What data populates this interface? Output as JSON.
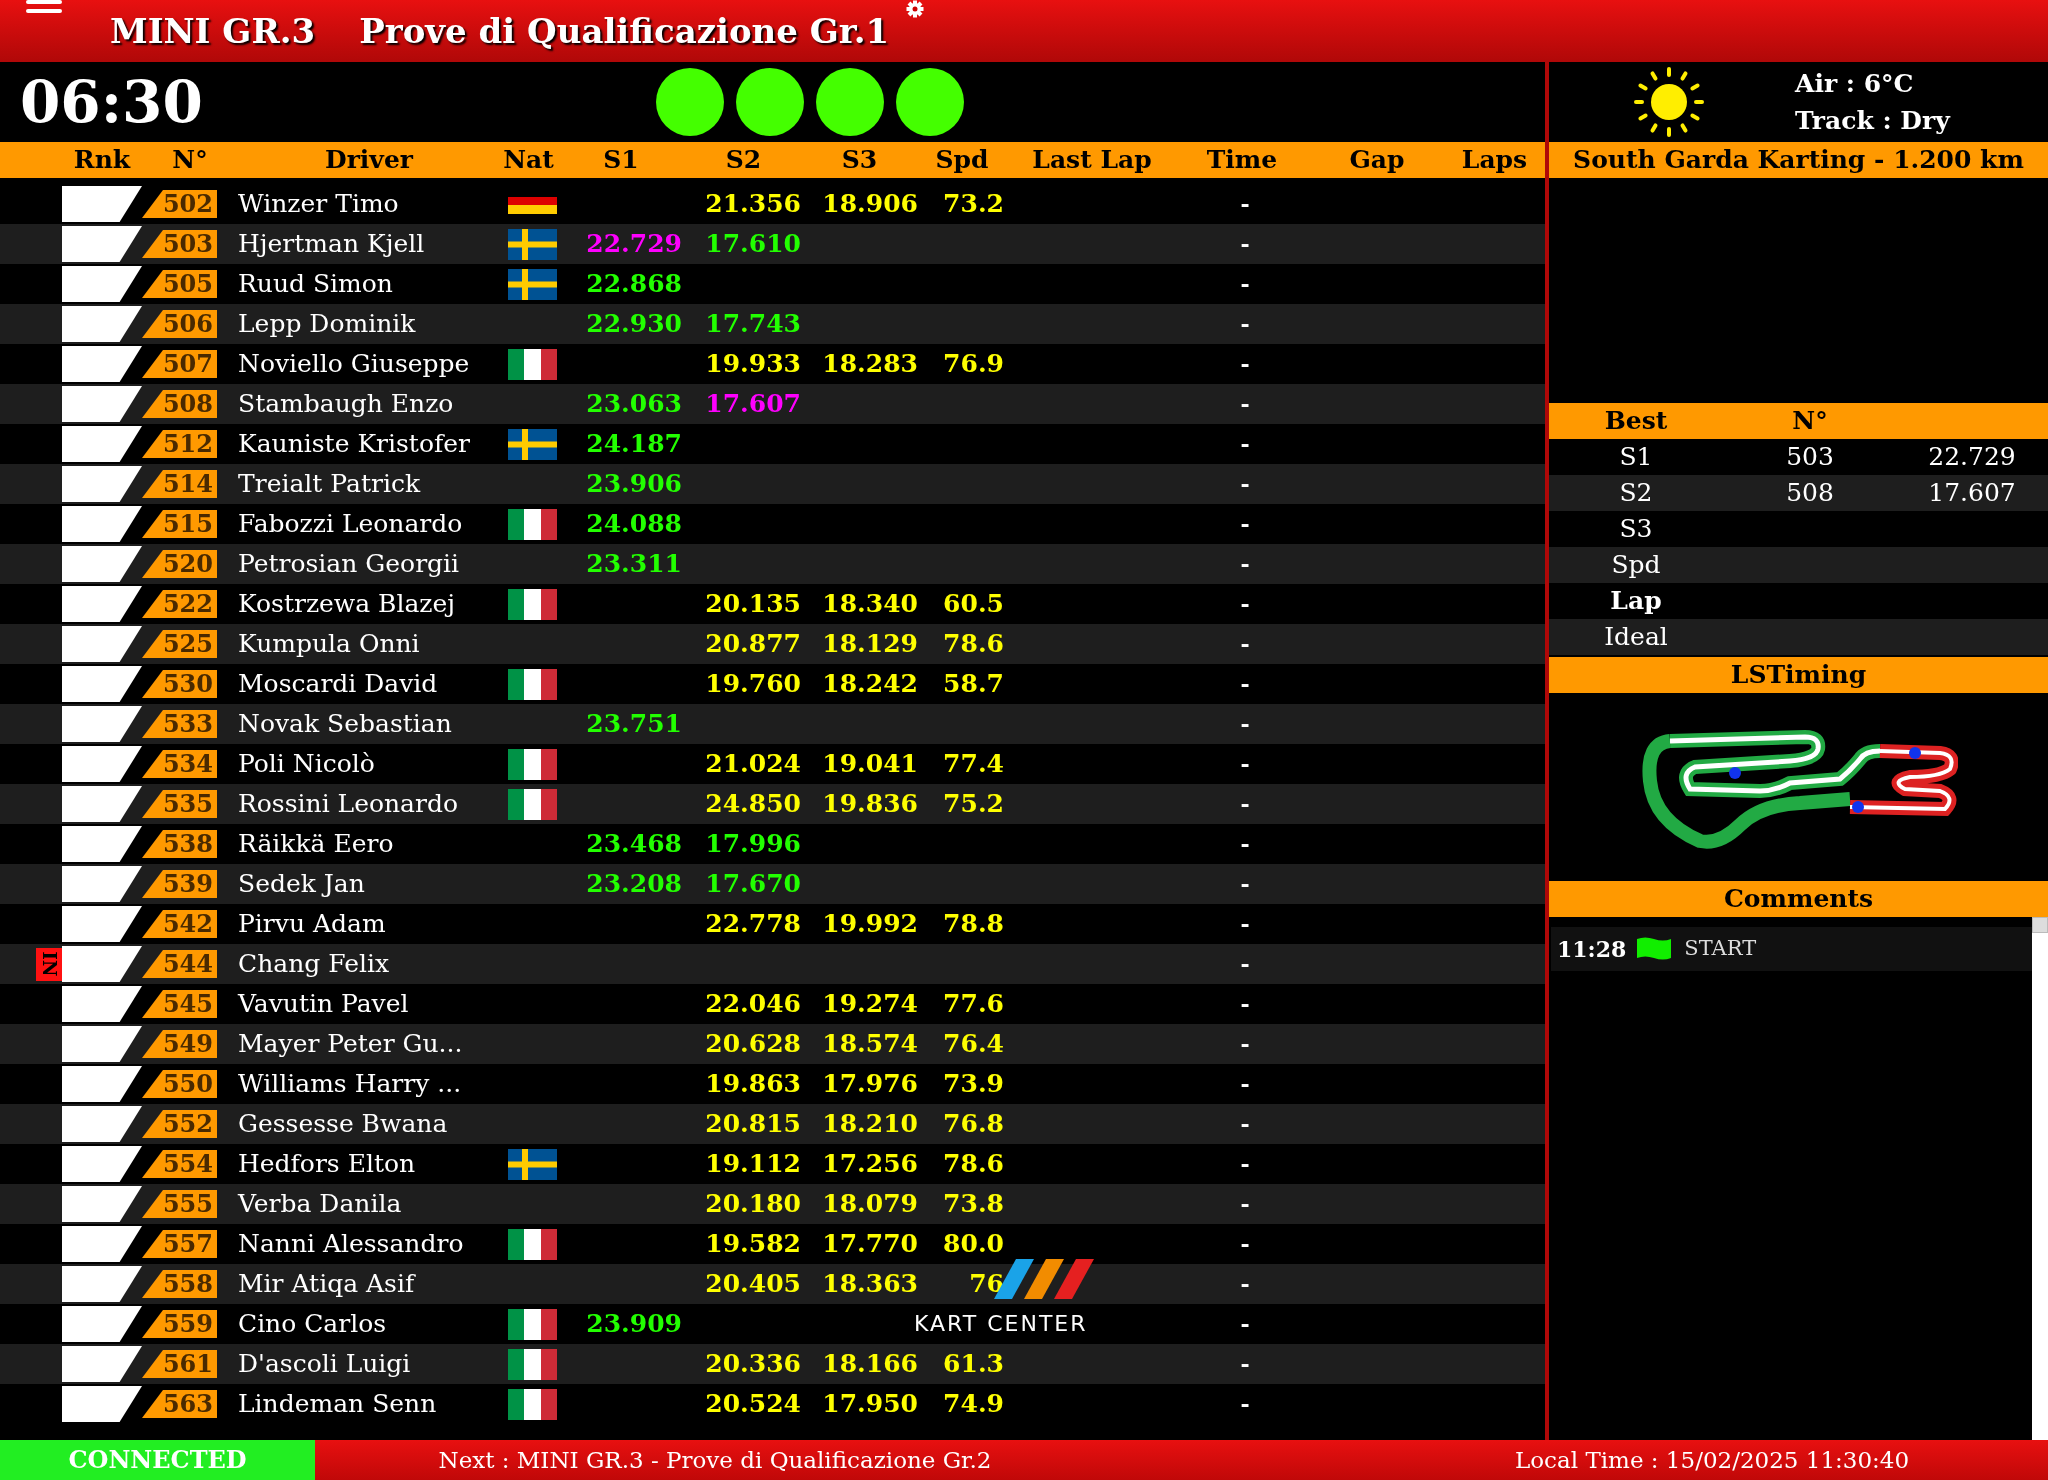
{
  "header": {
    "category": "MINI GR.3",
    "session": "Prove di Qualificazione Gr.1"
  },
  "timer": "06:30",
  "lights": [
    {
      "on": true
    },
    {
      "on": true
    },
    {
      "on": true
    },
    {
      "on": true
    }
  ],
  "columns": [
    "Rnk",
    "N°",
    "Driver",
    "Nat",
    "S1",
    "S2",
    "S3",
    "Spd",
    "Last Lap",
    "Time",
    "Gap",
    "Laps"
  ],
  "rows": [
    {
      "number": "502",
      "driver": "Winzer Timo",
      "nat": {
        "kind": "de"
      },
      "s2": {
        "text": "21.356",
        "kind": "normal"
      },
      "s3": {
        "text": "18.906",
        "kind": "normal"
      },
      "spd": "73.2",
      "time": "-"
    },
    {
      "number": "503",
      "driver": "Hjertman Kjell",
      "nat": {
        "kind": "se"
      },
      "s1": {
        "text": "22.729",
        "kind": "overall"
      },
      "s2": {
        "text": "17.610",
        "kind": "personal"
      },
      "time": "-"
    },
    {
      "number": "505",
      "driver": "Ruud Simon",
      "nat": {
        "kind": "se"
      },
      "s1": {
        "text": "22.868",
        "kind": "personal"
      },
      "time": "-"
    },
    {
      "number": "506",
      "driver": "Lepp Dominik",
      "s1": {
        "text": "22.930",
        "kind": "personal"
      },
      "s2": {
        "text": "17.743",
        "kind": "personal"
      },
      "time": "-"
    },
    {
      "number": "507",
      "driver": "Noviello Giuseppe",
      "nat": {
        "kind": "it"
      },
      "s2": {
        "text": "19.933",
        "kind": "normal"
      },
      "s3": {
        "text": "18.283",
        "kind": "normal"
      },
      "spd": "76.9",
      "time": "-"
    },
    {
      "number": "508",
      "driver": "Stambaugh Enzo",
      "s1": {
        "text": "23.063",
        "kind": "personal"
      },
      "s2": {
        "text": "17.607",
        "kind": "overall"
      },
      "time": "-"
    },
    {
      "number": "512",
      "driver": "Kauniste Kristofer",
      "nat": {
        "kind": "se"
      },
      "s1": {
        "text": "24.187",
        "kind": "personal"
      },
      "time": "-"
    },
    {
      "number": "514",
      "driver": "Treialt Patrick",
      "s1": {
        "text": "23.906",
        "kind": "personal"
      },
      "time": "-"
    },
    {
      "number": "515",
      "driver": "Fabozzi Leonardo",
      "nat": {
        "kind": "it"
      },
      "s1": {
        "text": "24.088",
        "kind": "personal"
      },
      "time": "-"
    },
    {
      "number": "520",
      "driver": "Petrosian Georgii",
      "s1": {
        "text": "23.311",
        "kind": "personal"
      },
      "time": "-"
    },
    {
      "number": "522",
      "driver": "Kostrzewa Blazej",
      "nat": {
        "kind": "it"
      },
      "s2": {
        "text": "20.135",
        "kind": "normal"
      },
      "s3": {
        "text": "18.340",
        "kind": "normal"
      },
      "spd": "60.5",
      "time": "-"
    },
    {
      "number": "525",
      "driver": "Kumpula Onni",
      "s2": {
        "text": "20.877",
        "kind": "normal"
      },
      "s3": {
        "text": "18.129",
        "kind": "normal"
      },
      "spd": "78.6",
      "time": "-"
    },
    {
      "number": "530",
      "driver": "Moscardi David",
      "nat": {
        "kind": "it"
      },
      "s2": {
        "text": "19.760",
        "kind": "normal"
      },
      "s3": {
        "text": "18.242",
        "kind": "normal"
      },
      "spd": "58.7",
      "time": "-"
    },
    {
      "number": "533",
      "driver": "Novak Sebastian",
      "s1": {
        "text": "23.751",
        "kind": "personal"
      },
      "time": "-"
    },
    {
      "number": "534",
      "driver": "Poli Nicolò",
      "nat": {
        "kind": "it"
      },
      "s2": {
        "text": "21.024",
        "kind": "normal"
      },
      "s3": {
        "text": "19.041",
        "kind": "normal"
      },
      "spd": "77.4",
      "time": "-"
    },
    {
      "number": "535",
      "driver": "Rossini Leonardo",
      "nat": {
        "kind": "it"
      },
      "s2": {
        "text": "24.850",
        "kind": "normal"
      },
      "s3": {
        "text": "19.836",
        "kind": "normal"
      },
      "spd": "75.2",
      "time": "-"
    },
    {
      "number": "538",
      "driver": "Räikkä Eero",
      "s1": {
        "text": "23.468",
        "kind": "personal"
      },
      "s2": {
        "text": "17.996",
        "kind": "personal"
      },
      "time": "-"
    },
    {
      "number": "539",
      "driver": "Sedek Jan",
      "s1": {
        "text": "23.208",
        "kind": "personal"
      },
      "s2": {
        "text": "17.670",
        "kind": "personal"
      },
      "time": "-"
    },
    {
      "number": "542",
      "driver": "Pirvu Adam",
      "s2": {
        "text": "22.778",
        "kind": "normal"
      },
      "s3": {
        "text": "19.992",
        "kind": "normal"
      },
      "spd": "78.8",
      "time": "-"
    },
    {
      "number": "544",
      "driver": "Chang Felix",
      "status": "IN",
      "time": "-"
    },
    {
      "number": "545",
      "driver": "Vavutin Pavel",
      "s2": {
        "text": "22.046",
        "kind": "normal"
      },
      "s3": {
        "text": "19.274",
        "kind": "normal"
      },
      "spd": "77.6",
      "time": "-"
    },
    {
      "number": "549",
      "driver": "Mayer Peter Gu...",
      "s2": {
        "text": "20.628",
        "kind": "normal"
      },
      "s3": {
        "text": "18.574",
        "kind": "normal"
      },
      "spd": "76.4",
      "time": "-"
    },
    {
      "number": "550",
      "driver": "Williams Harry ...",
      "s2": {
        "text": "19.863",
        "kind": "normal"
      },
      "s3": {
        "text": "17.976",
        "kind": "normal"
      },
      "spd": "73.9",
      "time": "-"
    },
    {
      "number": "552",
      "driver": "Gessesse Bwana",
      "s2": {
        "text": "20.815",
        "kind": "normal"
      },
      "s3": {
        "text": "18.210",
        "kind": "normal"
      },
      "spd": "76.8",
      "time": "-"
    },
    {
      "number": "554",
      "driver": "Hedfors Elton",
      "nat": {
        "kind": "se"
      },
      "s2": {
        "text": "19.112",
        "kind": "normal"
      },
      "s3": {
        "text": "17.256",
        "kind": "normal"
      },
      "spd": "78.6",
      "time": "-"
    },
    {
      "number": "555",
      "driver": "Verba Danila",
      "s2": {
        "text": "20.180",
        "kind": "normal"
      },
      "s3": {
        "text": "18.079",
        "kind": "normal"
      },
      "spd": "73.8",
      "time": "-"
    },
    {
      "number": "557",
      "driver": "Nanni Alessandro",
      "nat": {
        "kind": "it"
      },
      "s2": {
        "text": "19.582",
        "kind": "normal"
      },
      "s3": {
        "text": "17.770",
        "kind": "normal"
      },
      "spd": "80.0",
      "time": "-"
    },
    {
      "number": "558",
      "driver": "Mir Atiqa Asif",
      "s2": {
        "text": "20.405",
        "kind": "normal"
      },
      "s3": {
        "text": "18.363",
        "kind": "normal"
      },
      "spd": "76",
      "time": "-"
    },
    {
      "number": "559",
      "driver": "Cino Carlos",
      "nat": {
        "kind": "it"
      },
      "s1": {
        "text": "23.909",
        "kind": "personal"
      },
      "time": "-"
    },
    {
      "number": "561",
      "driver": "D'ascoli Luigi",
      "nat": {
        "kind": "it"
      },
      "s2": {
        "text": "20.336",
        "kind": "normal"
      },
      "s3": {
        "text": "18.166",
        "kind": "normal"
      },
      "spd": "61.3",
      "time": "-"
    },
    {
      "number": "563",
      "driver": "Lindeman Senn",
      "nat": {
        "kind": "it"
      },
      "s2": {
        "text": "20.524",
        "kind": "normal"
      },
      "s3": {
        "text": "17.950",
        "kind": "normal"
      },
      "spd": "74.9",
      "time": "-"
    }
  ],
  "logo": {
    "text": "KART CENTER"
  },
  "weather": {
    "air": "Air : 6°C",
    "track": "Track : Dry"
  },
  "track_name": "South Garda Karting - 1.200 km",
  "best": {
    "columns": [
      "Best",
      "N°"
    ],
    "rows": [
      {
        "label": "S1",
        "number": "503",
        "value": "22.729",
        "bold": false
      },
      {
        "label": "S2",
        "number": "508",
        "value": "17.607",
        "bold": false
      },
      {
        "label": "S3",
        "bold": false
      },
      {
        "label": "Spd",
        "bold": false
      },
      {
        "label": "Lap",
        "bold": true
      },
      {
        "label": "Ideal",
        "bold": false
      }
    ]
  },
  "map_title": "LSTiming",
  "comments": {
    "title": "Comments",
    "items": [
      {
        "time": "11:28",
        "text": "START"
      }
    ]
  },
  "status_bar": {
    "connection": "CONNECTED",
    "next": "Next : MINI GR.3 - Prove di Qualificazione Gr.2",
    "local_time": "Local Time : 15/02/2025 11:30:40"
  }
}
